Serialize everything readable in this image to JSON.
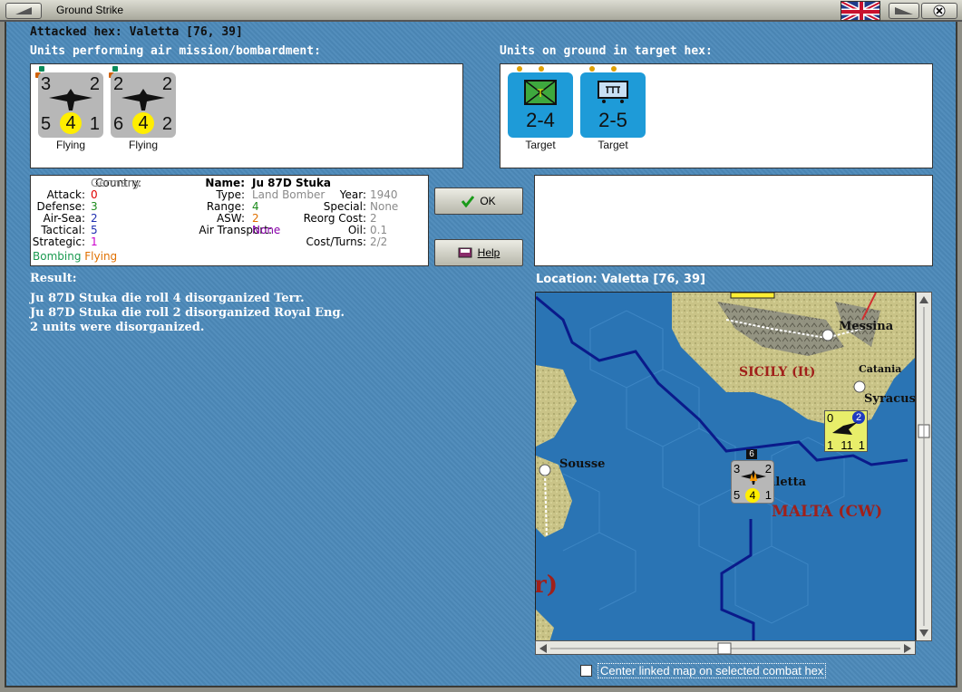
{
  "window": {
    "title": "Ground Strike"
  },
  "attacked_hex": "Attacked hex: Valetta  [76, 39]",
  "air_units_header": "Units performing air mission/bombardment:",
  "ground_units_header": "Units on ground in target hex:",
  "air_units": [
    {
      "tl": "3",
      "tr": "2",
      "bl": "5",
      "center": "4",
      "br": "1",
      "status": "Flying"
    },
    {
      "tl": "2",
      "tr": "2",
      "bl": "6",
      "center": "4",
      "br": "2",
      "status": "Flying"
    }
  ],
  "ground_units": [
    {
      "value": "2-4",
      "status": "Target",
      "icon": "engineer-terrain-icon"
    },
    {
      "value": "2-5",
      "status": "Target",
      "icon": "engineer-icon"
    }
  ],
  "unit_info": {
    "country_label": "Country:",
    "country": "Germany",
    "attack_label": "Attack:",
    "attack": "0",
    "defense_label": "Defense:",
    "defense": "3",
    "airsea_label": "Air-Sea:",
    "airsea": "2",
    "tactical_label": "Tactical:",
    "tactical": "5",
    "strategic_label": "Strategic:",
    "strategic": "1",
    "mission": "Bombing",
    "mission_status": "Flying",
    "name_label": "Name:",
    "name": "Ju 87D Stuka",
    "type_label": "Type:",
    "type": "Land Bomber",
    "year_label": "Year:",
    "year": "1940",
    "range_label": "Range:",
    "range": "4",
    "special_label": "Special:",
    "special": "None",
    "asw_label": "ASW:",
    "asw": "2",
    "reorg_label": "Reorg Cost:",
    "reorg": "2",
    "airtransport_label": "Air Transport:",
    "airtransport": "None",
    "oil_label": "Oil:",
    "oil": "0.1",
    "cost_label": "Cost/Turns:",
    "cost": "2/2"
  },
  "buttons": {
    "ok": "OK",
    "help": "Help"
  },
  "result": {
    "header": "Result:",
    "lines": [
      "Ju 87D Stuka die roll 4 disorganized Terr.",
      "Ju 87D Stuka die roll 2 disorganized Royal Eng.",
      "2 units were disorganized."
    ]
  },
  "location": "Location:  Valetta  [76, 39]",
  "map": {
    "labels": {
      "messina": "Messina",
      "sicily": "SICILY (It)",
      "catania": "Catania",
      "syracuse": "Syracus",
      "sousse": "Sousse",
      "valletta": "aletta",
      "malta": "MALTA (CW)",
      "r": "r)"
    },
    "stack_unit": {
      "tl": "3",
      "tr": "2",
      "bl": "5",
      "center": "4",
      "br": "1",
      "count": "6"
    },
    "enemy_unit": {
      "tl": "0",
      "badge": "2",
      "bl": "1",
      "center": "11",
      "br": "1"
    }
  },
  "checkbox": {
    "label": "Center linked map on selected combat hex",
    "checked": false
  },
  "colors": {
    "background": "#4c89b9",
    "attack": "#e00000",
    "defense": "#1a8a1a",
    "airsea": "#1f2fb0",
    "tactical": "#1f2fb0",
    "strategic": "#cc00cc",
    "country": "#8a8a8a",
    "range": "#1a8a1a",
    "asw": "#e07000",
    "airtransport": "#8800aa",
    "mission": "#1a9a50",
    "mission_status": "#e07000"
  }
}
